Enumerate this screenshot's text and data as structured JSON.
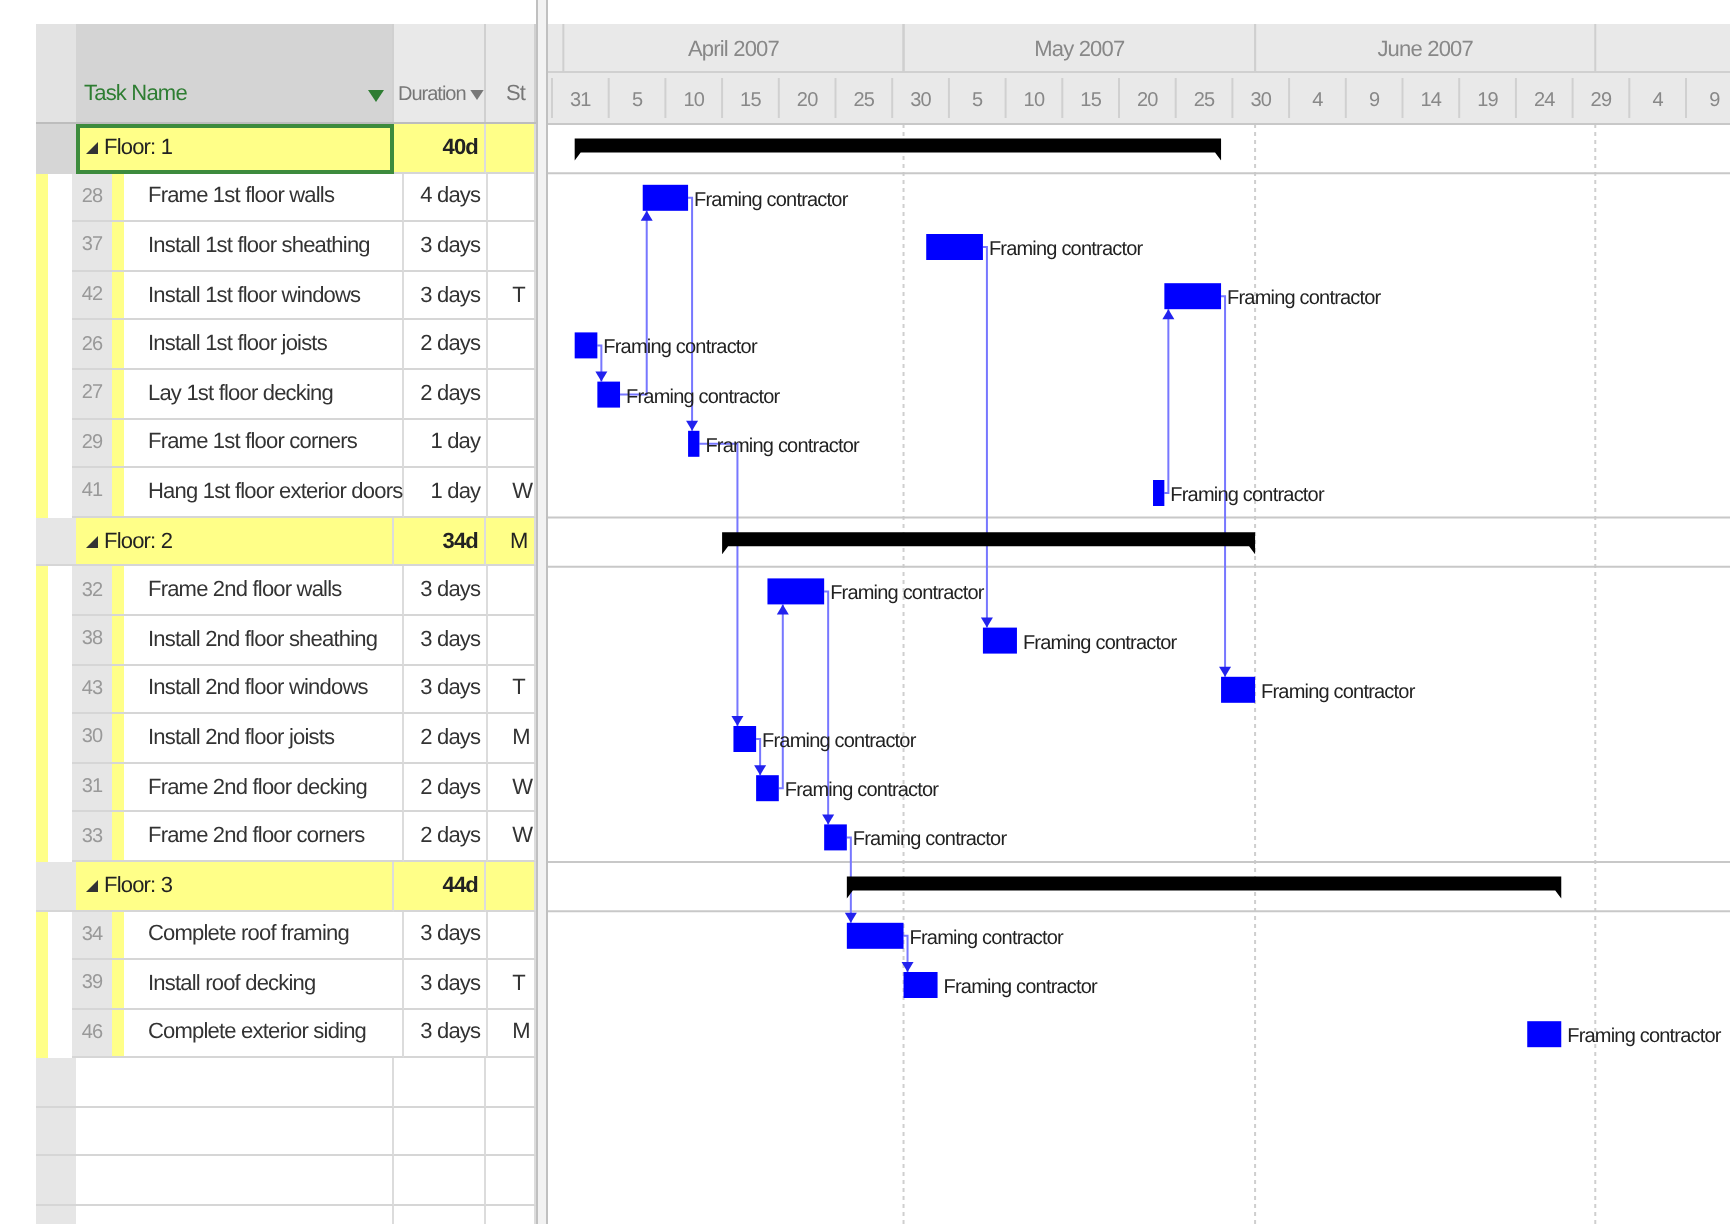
{
  "table": {
    "columns": [
      {
        "label": "Task Name",
        "filter": true
      },
      {
        "label": "Duration",
        "filter": true
      },
      {
        "label": "St"
      }
    ],
    "rows": [
      {
        "kind": "summary",
        "name": "Floor: 1",
        "duration": "40d",
        "column_3": "",
        "expanded": true,
        "selected": true
      },
      {
        "kind": "task",
        "id": "28",
        "name": "Frame 1st floor walls",
        "duration": "4 days",
        "column_3": "",
        "selected": false,
        "resource": "Framing contractor"
      },
      {
        "kind": "task",
        "id": "37",
        "name": "Install 1st floor sheathing",
        "duration": "3 days",
        "column_3": "",
        "selected": false,
        "resource": "Framing contractor"
      },
      {
        "kind": "task",
        "id": "42",
        "name": "Install 1st floor windows",
        "duration": "3 days",
        "column_3": "T",
        "selected": false,
        "resource": "Framing contractor"
      },
      {
        "kind": "task",
        "id": "26",
        "name": "Install 1st floor joists",
        "duration": "2 days",
        "column_3": "",
        "selected": false,
        "resource": "Framing contractor"
      },
      {
        "kind": "task",
        "id": "27",
        "name": "Lay 1st floor decking",
        "duration": "2 days",
        "column_3": "",
        "selected": false,
        "resource": "Framing contractor"
      },
      {
        "kind": "task",
        "id": "29",
        "name": "Frame 1st floor corners",
        "duration": "1 day",
        "column_3": "",
        "selected": false,
        "resource": "Framing contractor"
      },
      {
        "kind": "task",
        "id": "41",
        "name": "Hang 1st floor exterior doors",
        "duration": "1 day",
        "column_3": "W",
        "selected": false,
        "resource": "Framing contractor"
      },
      {
        "kind": "summary",
        "name": "Floor: 2",
        "duration": "34d",
        "column_3": "M",
        "expanded": true,
        "selected": false
      },
      {
        "kind": "task",
        "id": "32",
        "name": "Frame 2nd floor walls",
        "duration": "3 days",
        "column_3": "",
        "selected": false,
        "resource": "Framing contractor"
      },
      {
        "kind": "task",
        "id": "38",
        "name": "Install 2nd floor sheathing",
        "duration": "3 days",
        "column_3": "",
        "selected": false,
        "resource": "Framing contractor"
      },
      {
        "kind": "task",
        "id": "43",
        "name": "Install 2nd floor windows",
        "duration": "3 days",
        "column_3": "T",
        "selected": false,
        "resource": "Framing contractor"
      },
      {
        "kind": "task",
        "id": "30",
        "name": "Install 2nd floor joists",
        "duration": "2 days",
        "column_3": "M",
        "selected": false,
        "resource": "Framing contractor"
      },
      {
        "kind": "task",
        "id": "31",
        "name": "Frame 2nd floor decking",
        "duration": "2 days",
        "column_3": "W",
        "selected": false,
        "resource": "Framing contractor"
      },
      {
        "kind": "task",
        "id": "33",
        "name": "Frame 2nd floor corners",
        "duration": "2 days",
        "column_3": "W",
        "selected": false,
        "resource": "Framing contractor"
      },
      {
        "kind": "summary",
        "name": "Floor: 3",
        "duration": "44d",
        "column_3": "",
        "expanded": true,
        "selected": false
      },
      {
        "kind": "task",
        "id": "34",
        "name": "Complete roof framing",
        "duration": "3 days",
        "column_3": "",
        "selected": false,
        "resource": "Framing contractor"
      },
      {
        "kind": "task",
        "id": "39",
        "name": "Install roof decking",
        "duration": "3 days",
        "column_3": "T",
        "selected": false,
        "resource": "Framing contractor"
      },
      {
        "kind": "task",
        "id": "46",
        "name": "Complete exterior siding",
        "duration": "3 days",
        "column_3": "M",
        "selected": false,
        "resource": "Framing contractor"
      }
    ]
  },
  "timescale": {
    "months": [
      "April 2007",
      "May 2007",
      "June 2007"
    ],
    "ticks": [
      "31",
      "5",
      "10",
      "15",
      "20",
      "25",
      "30",
      "5",
      "10",
      "15",
      "20",
      "25",
      "30",
      "4",
      "9",
      "14",
      "19",
      "24",
      "29",
      "4",
      "9"
    ]
  }
}
